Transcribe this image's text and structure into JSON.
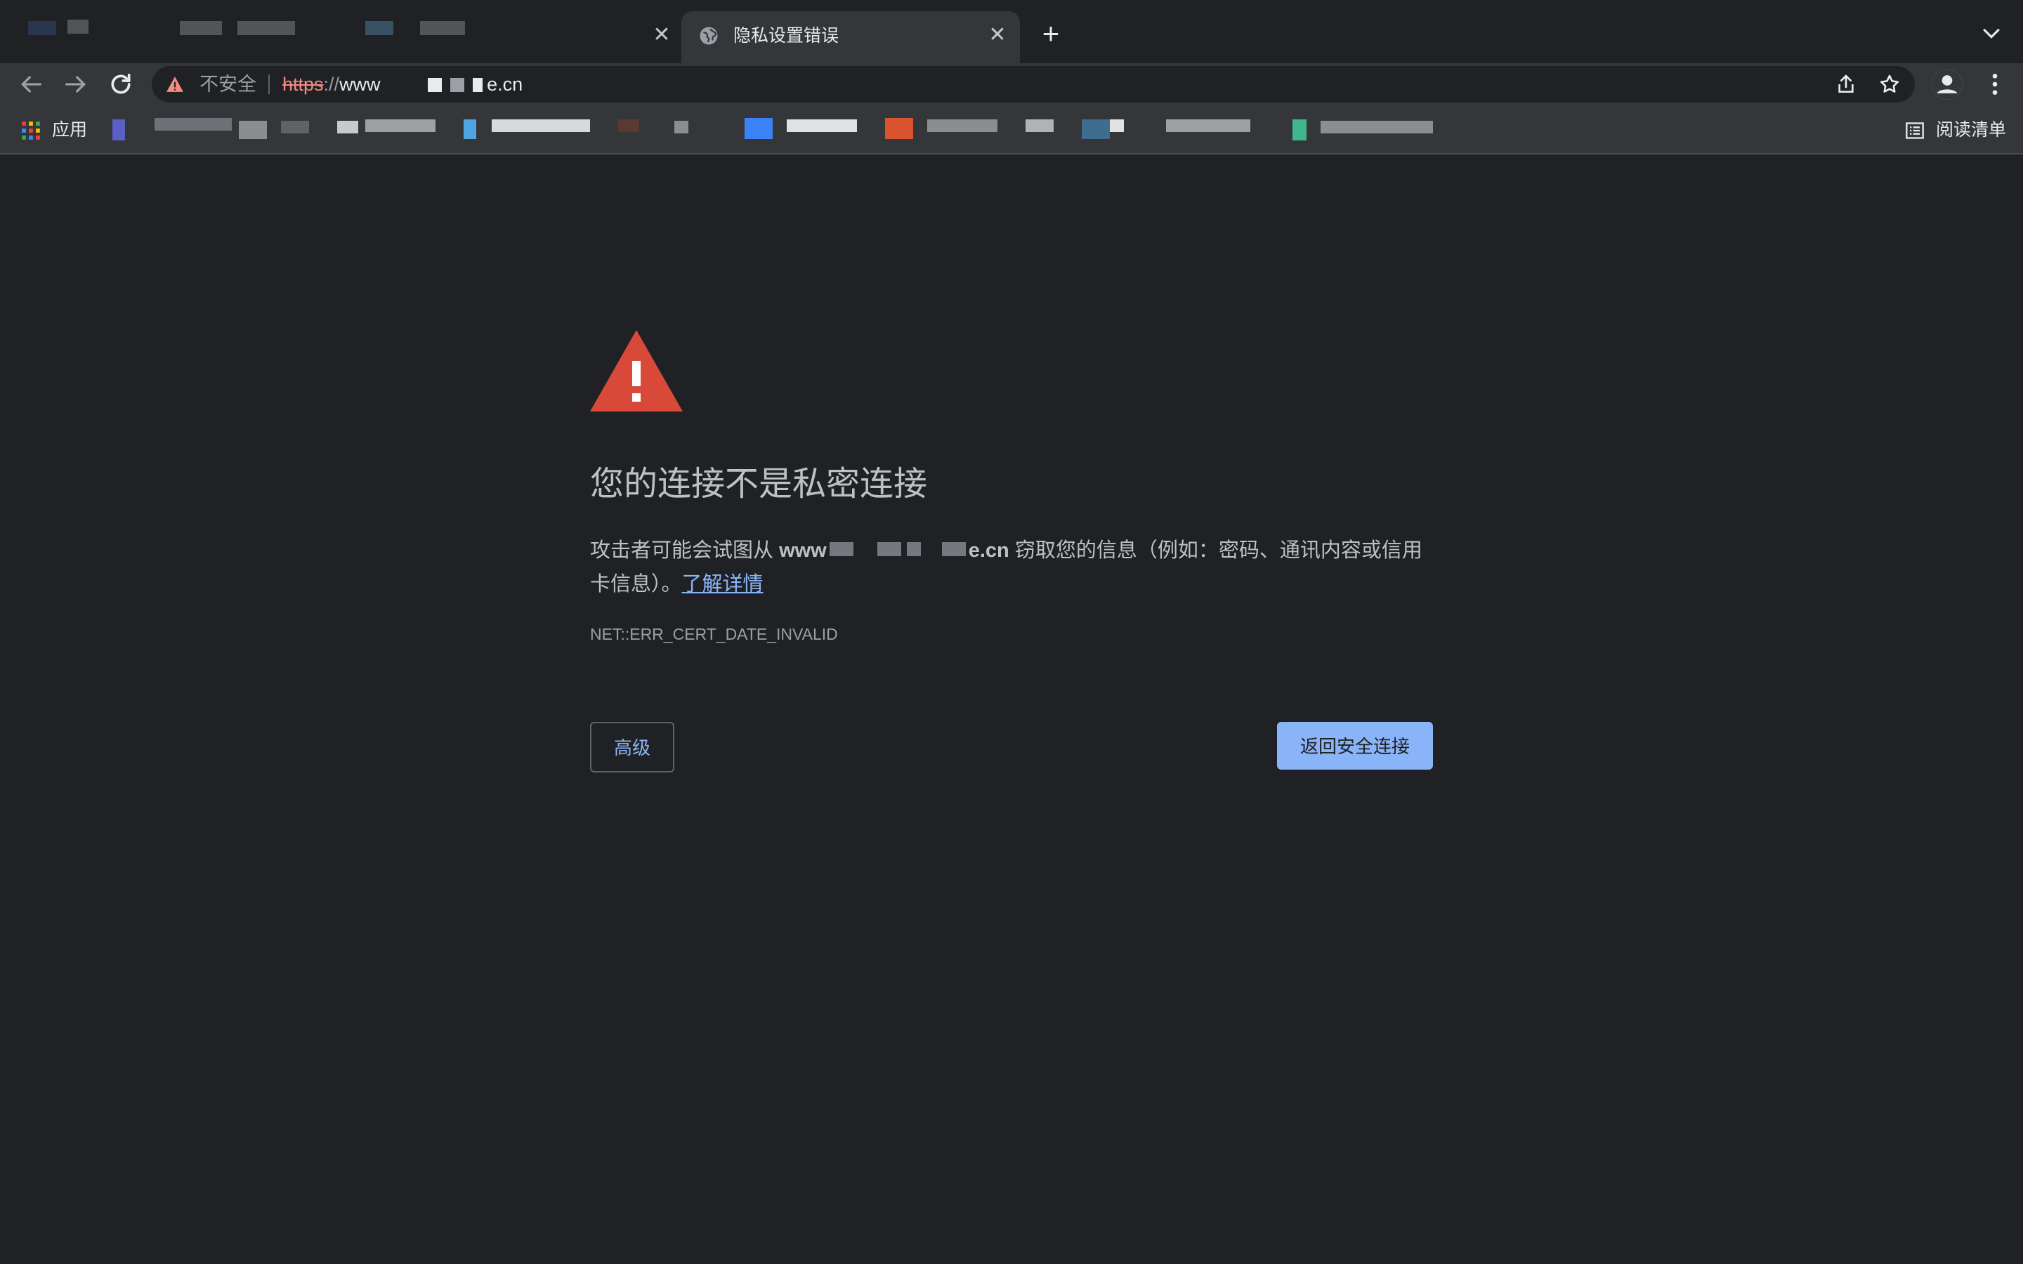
{
  "browser": {
    "tabs": [
      {
        "title": "",
        "active": false
      },
      {
        "title": "隐私设置错误",
        "active": true
      }
    ],
    "new_tab_label": "+",
    "close_glyph": "✕"
  },
  "omnibox": {
    "security_label": "不安全",
    "url_scheme": "https",
    "url_separator": "://",
    "url_prefix": "www",
    "url_suffix": "e.cn"
  },
  "bookmarks": {
    "apps_label": "应用",
    "reading_list_label": "阅读清单"
  },
  "interstitial": {
    "heading": "您的连接不是私密连接",
    "body_before": "攻击者可能会试图从 ",
    "domain_prefix": "www",
    "domain_suffix": "e.cn",
    "body_after": " 窃取您的信息（例如：密码、通讯内容或信用卡信息）。",
    "learn_more": "了解详情",
    "error_code": "NET::ERR_CERT_DATE_INVALID",
    "advanced_button": "高级",
    "back_button": "返回安全连接"
  },
  "colors": {
    "background": "#202124",
    "toolbar": "#35363a",
    "warning_red": "#d9493a",
    "link_blue": "#8ab4f8",
    "insecure_red": "#f28b82"
  },
  "icons": [
    "globe-icon",
    "back-arrow-icon",
    "forward-arrow-icon",
    "reload-icon",
    "warning-icon",
    "share-icon",
    "star-icon",
    "profile-icon",
    "more-vert-icon",
    "apps-grid-icon",
    "reading-list-icon",
    "chevron-down-icon"
  ]
}
